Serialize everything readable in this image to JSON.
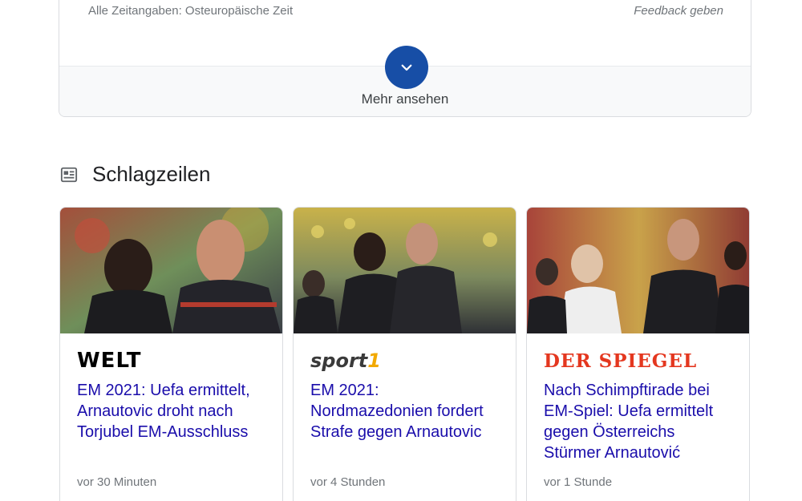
{
  "top_card": {
    "timezone_note": "Alle Zeitangaben: Osteuropäische Zeit",
    "feedback": "Feedback geben",
    "more_label": "Mehr ansehen",
    "more_icon": "chevron-down-icon"
  },
  "section": {
    "icon": "newspaper-icon",
    "title": "Schlagzeilen"
  },
  "articles": [
    {
      "source": "WELT",
      "headline": "EM 2021: Uefa ermittelt, Arnautovic droht nach Torjubel EM-Ausschluss",
      "time": "vor 30 Minuten"
    },
    {
      "source_text": "sport",
      "source_suffix": "1",
      "headline": "EM 2021: Nordmazedonien fordert Strafe gegen Arnautovic",
      "time": "vor 4 Stunden"
    },
    {
      "source": "DER SPIEGEL",
      "headline": "Nach Schimpftirade bei EM-Spiel: Uefa ermittelt gegen Österreichs Stürmer Arnautović",
      "time": "vor 1 Stunde"
    }
  ],
  "colors": {
    "link": "#1a0dab",
    "accent_button": "#174ea6",
    "spiegel_red": "#e4371f",
    "sport1_yellow": "#f2a900"
  }
}
